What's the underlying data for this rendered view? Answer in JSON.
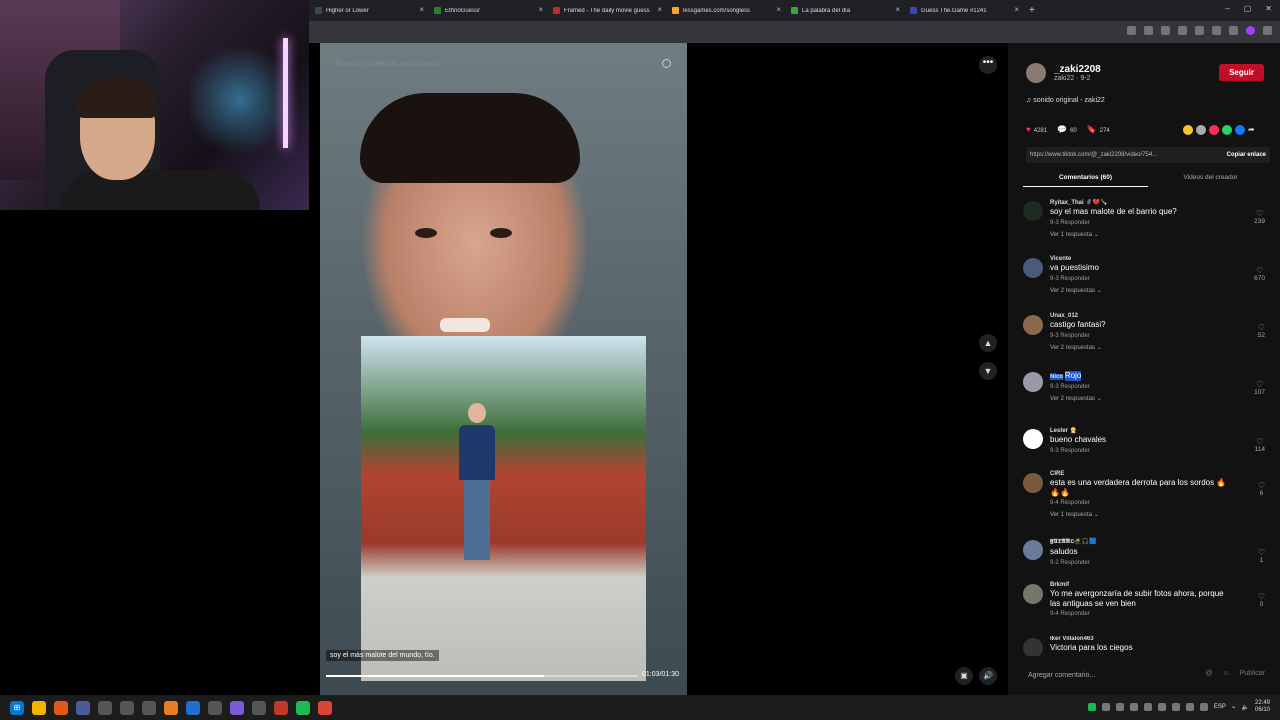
{
  "browser": {
    "tabs": [
      {
        "title": "Higher or Lower",
        "color": "#444"
      },
      {
        "title": "EthnoGuessr",
        "color": "#2e7d32"
      },
      {
        "title": "Framed - The daily movie guess",
        "color": "#c62828"
      },
      {
        "title": "lessgames.com/songless",
        "color": "#f9a825"
      },
      {
        "title": "La palabra del día",
        "color": "#43a047"
      },
      {
        "title": "Guess The.Game #1241",
        "color": "#3949ab"
      }
    ],
    "new_tab": "+"
  },
  "video": {
    "search_placeholder": "Buscar contenido relacionado",
    "caption": "soy el más malote del mundo, tío.",
    "time": "01:03/01:30",
    "progress": 0.7
  },
  "panel": {
    "username": "_zaki2208",
    "subline": "zaki22 · 9-2",
    "follow_label": "Seguir",
    "sound": "♫ sonido original - zaki22",
    "likes": "4281",
    "comments_count": "60",
    "saves": "274",
    "link": "https://www.tiktok.com/@_zaki2208/video/754...",
    "copy_label": "Copiar enlace",
    "tab_comments": "Comentarios (60)",
    "tab_creator": "Videos del creador",
    "add_comment": "Agregar comentario...",
    "publish": "Publicar",
    "comments": [
      {
        "user": "Ryitax_Thai 🦸💔🍾",
        "text": "soy el mas malote de el barrio que?",
        "meta": "9-3    Responder",
        "reply": "Ver 1 respuesta ⌄",
        "likes": "239",
        "color": "#1f2a22"
      },
      {
        "user": "Vicente",
        "text": "va puestisimo",
        "meta": "9-3    Responder",
        "reply": "Ver 2 respuestas ⌄",
        "likes": "670",
        "color": "#4a5a7a"
      },
      {
        "user": "Unax_012",
        "text": "castigo fantasi?",
        "meta": "9-3    Responder",
        "reply": "Ver 2 respuestas ⌄",
        "likes": "52",
        "color": "#8a6a4a"
      },
      {
        "user": "Nico",
        "text": "Rojo",
        "meta": "9-3    Responder",
        "reply": "Ver 2 respuestas ⌄",
        "likes": "107",
        "color": "#99a"
      },
      {
        "user": "Lester 🧑‍🎄",
        "text": "bueno chavales",
        "meta": "9-3    Responder",
        "reply": "",
        "likes": "114",
        "color": "#fff"
      },
      {
        "user": "CIRE",
        "text": "esta es una verdadera derrota para los sordos 🔥🔥🔥",
        "meta": "9-4    Responder",
        "reply": "Ver 1 respuesta ⌄",
        "likes": "6",
        "color": "#7a5a3a"
      },
      {
        "user": "𝕱𝖀𝕿𝕬𝕽𝕺🥷🎧🟦",
        "text": "saludos",
        "meta": "9-2    Responder",
        "reply": "",
        "likes": "1",
        "color": "#6a7a9a"
      },
      {
        "user": "Brkmif",
        "text": "Yo me avergonzaría de subir fotos ahora, porque las antiguas se ven bien",
        "meta": "9-4    Responder",
        "reply": "",
        "likes": "0",
        "color": "#776"
      },
      {
        "user": "Iker Villalon463",
        "text": "Victoria para los ciegos",
        "meta": "",
        "reply": "",
        "likes": "",
        "color": "#333"
      }
    ]
  },
  "taskbar": {
    "lang": "ESP",
    "time": "22:49",
    "date": "06/10"
  }
}
